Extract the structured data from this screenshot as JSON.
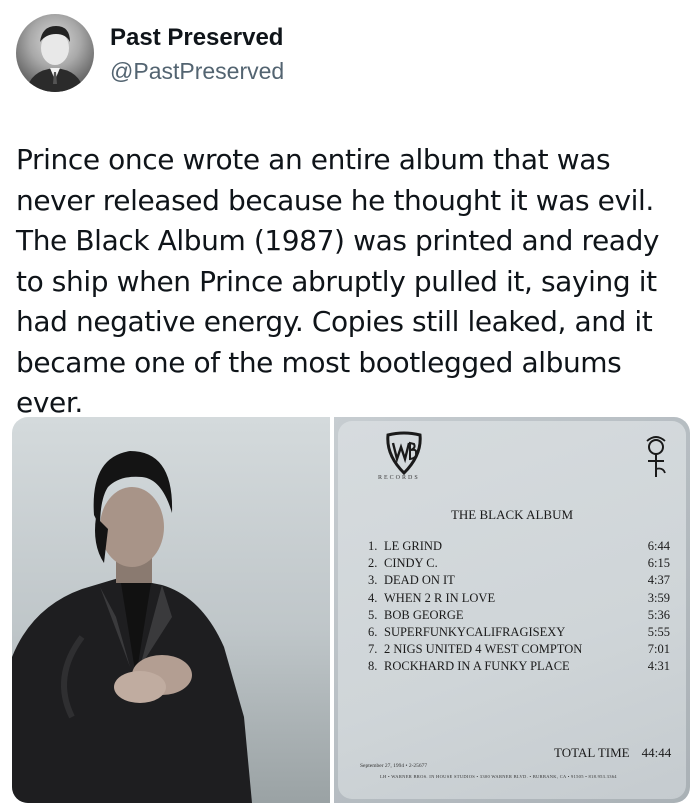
{
  "author": {
    "name": "Past Preserved",
    "handle": "@PastPreserved"
  },
  "tweet": {
    "text": "Prince once wrote an entire album that was never released because he thought it was evil. The Black Album (1987) was printed and ready to ship when Prince abruptly pulled it, saying it had negative energy. Copies still leaked, and it became one of the most bootlegged albums ever."
  },
  "album_card": {
    "label_text": "RECORDS",
    "title": "THE BLACK ALBUM",
    "tracks": [
      {
        "num": "1.",
        "title": "LE GRIND",
        "time": "6:44"
      },
      {
        "num": "2.",
        "title": "CINDY C.",
        "time": "6:15"
      },
      {
        "num": "3.",
        "title": "DEAD ON IT",
        "time": "4:37"
      },
      {
        "num": "4.",
        "title": "WHEN 2 R IN LOVE",
        "time": "3:59"
      },
      {
        "num": "5.",
        "title": "BOB GEORGE",
        "time": "5:36"
      },
      {
        "num": "6.",
        "title": "SUPERFUNKYCALIFRAGISEXY",
        "time": "5:55"
      },
      {
        "num": "7.",
        "title": "2 NIGS UNITED 4 WEST COMPTON",
        "time": "7:01"
      },
      {
        "num": "8.",
        "title": "ROCKHARD IN A FUNKY PLACE",
        "time": "4:31"
      }
    ],
    "total_label": "TOTAL TIME",
    "total_time": "44:44",
    "date_line": "September 27, 1994 • 2-25677",
    "credit_line": "LH • WARNER BROS. IN HOUSE STUDIOS • 3300 WARNER BLVD. • BURBANK, CA • 91505 • 818.953.3364"
  },
  "colors": {
    "text_primary": "#0f1419",
    "text_secondary": "#536471",
    "background": "#ffffff"
  },
  "icons": {
    "avatar": "person-portrait",
    "wb_logo": "wb-shield-logo",
    "love_symbol": "prince-love-symbol-icon"
  }
}
